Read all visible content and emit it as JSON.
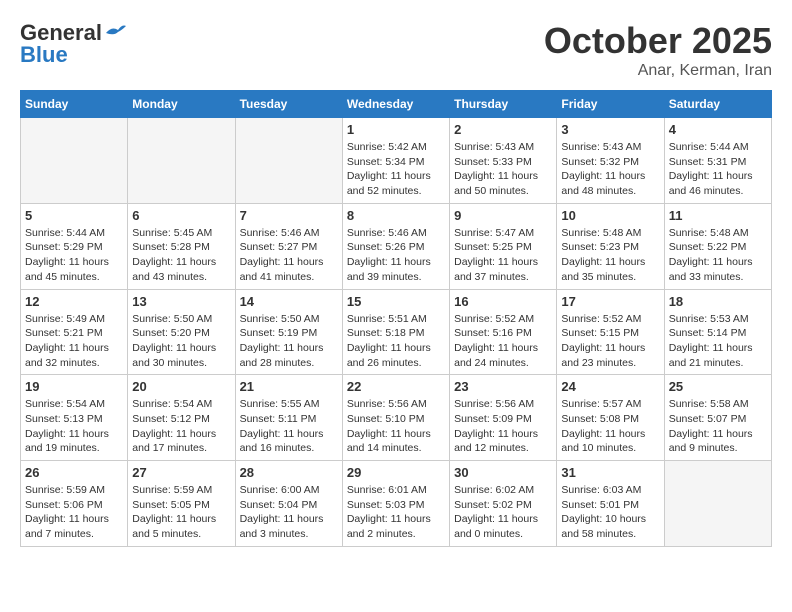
{
  "header": {
    "logo_general": "General",
    "logo_blue": "Blue",
    "month_title": "October 2025",
    "location": "Anar, Kerman, Iran"
  },
  "weekdays": [
    "Sunday",
    "Monday",
    "Tuesday",
    "Wednesday",
    "Thursday",
    "Friday",
    "Saturday"
  ],
  "weeks": [
    [
      {
        "day": "",
        "info": ""
      },
      {
        "day": "",
        "info": ""
      },
      {
        "day": "",
        "info": ""
      },
      {
        "day": "1",
        "info": "Sunrise: 5:42 AM\nSunset: 5:34 PM\nDaylight: 11 hours\nand 52 minutes."
      },
      {
        "day": "2",
        "info": "Sunrise: 5:43 AM\nSunset: 5:33 PM\nDaylight: 11 hours\nand 50 minutes."
      },
      {
        "day": "3",
        "info": "Sunrise: 5:43 AM\nSunset: 5:32 PM\nDaylight: 11 hours\nand 48 minutes."
      },
      {
        "day": "4",
        "info": "Sunrise: 5:44 AM\nSunset: 5:31 PM\nDaylight: 11 hours\nand 46 minutes."
      }
    ],
    [
      {
        "day": "5",
        "info": "Sunrise: 5:44 AM\nSunset: 5:29 PM\nDaylight: 11 hours\nand 45 minutes."
      },
      {
        "day": "6",
        "info": "Sunrise: 5:45 AM\nSunset: 5:28 PM\nDaylight: 11 hours\nand 43 minutes."
      },
      {
        "day": "7",
        "info": "Sunrise: 5:46 AM\nSunset: 5:27 PM\nDaylight: 11 hours\nand 41 minutes."
      },
      {
        "day": "8",
        "info": "Sunrise: 5:46 AM\nSunset: 5:26 PM\nDaylight: 11 hours\nand 39 minutes."
      },
      {
        "day": "9",
        "info": "Sunrise: 5:47 AM\nSunset: 5:25 PM\nDaylight: 11 hours\nand 37 minutes."
      },
      {
        "day": "10",
        "info": "Sunrise: 5:48 AM\nSunset: 5:23 PM\nDaylight: 11 hours\nand 35 minutes."
      },
      {
        "day": "11",
        "info": "Sunrise: 5:48 AM\nSunset: 5:22 PM\nDaylight: 11 hours\nand 33 minutes."
      }
    ],
    [
      {
        "day": "12",
        "info": "Sunrise: 5:49 AM\nSunset: 5:21 PM\nDaylight: 11 hours\nand 32 minutes."
      },
      {
        "day": "13",
        "info": "Sunrise: 5:50 AM\nSunset: 5:20 PM\nDaylight: 11 hours\nand 30 minutes."
      },
      {
        "day": "14",
        "info": "Sunrise: 5:50 AM\nSunset: 5:19 PM\nDaylight: 11 hours\nand 28 minutes."
      },
      {
        "day": "15",
        "info": "Sunrise: 5:51 AM\nSunset: 5:18 PM\nDaylight: 11 hours\nand 26 minutes."
      },
      {
        "day": "16",
        "info": "Sunrise: 5:52 AM\nSunset: 5:16 PM\nDaylight: 11 hours\nand 24 minutes."
      },
      {
        "day": "17",
        "info": "Sunrise: 5:52 AM\nSunset: 5:15 PM\nDaylight: 11 hours\nand 23 minutes."
      },
      {
        "day": "18",
        "info": "Sunrise: 5:53 AM\nSunset: 5:14 PM\nDaylight: 11 hours\nand 21 minutes."
      }
    ],
    [
      {
        "day": "19",
        "info": "Sunrise: 5:54 AM\nSunset: 5:13 PM\nDaylight: 11 hours\nand 19 minutes."
      },
      {
        "day": "20",
        "info": "Sunrise: 5:54 AM\nSunset: 5:12 PM\nDaylight: 11 hours\nand 17 minutes."
      },
      {
        "day": "21",
        "info": "Sunrise: 5:55 AM\nSunset: 5:11 PM\nDaylight: 11 hours\nand 16 minutes."
      },
      {
        "day": "22",
        "info": "Sunrise: 5:56 AM\nSunset: 5:10 PM\nDaylight: 11 hours\nand 14 minutes."
      },
      {
        "day": "23",
        "info": "Sunrise: 5:56 AM\nSunset: 5:09 PM\nDaylight: 11 hours\nand 12 minutes."
      },
      {
        "day": "24",
        "info": "Sunrise: 5:57 AM\nSunset: 5:08 PM\nDaylight: 11 hours\nand 10 minutes."
      },
      {
        "day": "25",
        "info": "Sunrise: 5:58 AM\nSunset: 5:07 PM\nDaylight: 11 hours\nand 9 minutes."
      }
    ],
    [
      {
        "day": "26",
        "info": "Sunrise: 5:59 AM\nSunset: 5:06 PM\nDaylight: 11 hours\nand 7 minutes."
      },
      {
        "day": "27",
        "info": "Sunrise: 5:59 AM\nSunset: 5:05 PM\nDaylight: 11 hours\nand 5 minutes."
      },
      {
        "day": "28",
        "info": "Sunrise: 6:00 AM\nSunset: 5:04 PM\nDaylight: 11 hours\nand 3 minutes."
      },
      {
        "day": "29",
        "info": "Sunrise: 6:01 AM\nSunset: 5:03 PM\nDaylight: 11 hours\nand 2 minutes."
      },
      {
        "day": "30",
        "info": "Sunrise: 6:02 AM\nSunset: 5:02 PM\nDaylight: 11 hours\nand 0 minutes."
      },
      {
        "day": "31",
        "info": "Sunrise: 6:03 AM\nSunset: 5:01 PM\nDaylight: 10 hours\nand 58 minutes."
      },
      {
        "day": "",
        "info": ""
      }
    ]
  ]
}
